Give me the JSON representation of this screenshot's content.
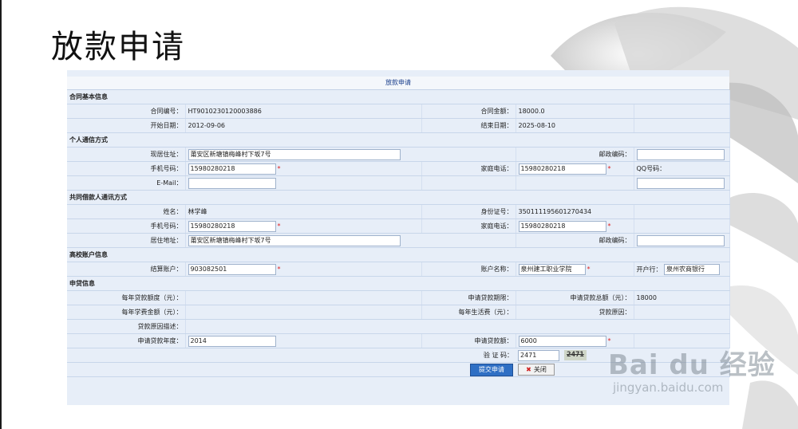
{
  "slide": {
    "title": "放款申请"
  },
  "watermark": {
    "brand": "Bai du 经验",
    "url": "jingyan.baidu.com"
  },
  "form": {
    "title": "放款申请",
    "sections": {
      "contract": "合同基本信息",
      "contact": "个人通信方式",
      "co_borrower": "共同借款人通讯方式",
      "bank": "高校账户信息",
      "apply": "申贷信息"
    },
    "contract": {
      "no_label": "合同编号：",
      "no": "HT9010230120003886",
      "amount_label": "合同金额：",
      "amount": "18000.0",
      "start_label": "开始日期：",
      "start": "2012-09-06",
      "end_label": "结束日期：",
      "end": "2025-08-10"
    },
    "contact": {
      "address_label": "现居住址：",
      "address": "莆安区新塘镇梅峰村下坂7号",
      "zip_label": "邮政编码：",
      "zip": "",
      "mobile_label": "手机号码：",
      "mobile": "15980280218",
      "home_label": "家庭电话：",
      "home": "15980280218",
      "qq_label": "QQ号码：",
      "qq": "",
      "email_label": "E-Mail：",
      "email": ""
    },
    "co_borrower": {
      "name_label": "姓名：",
      "name": "林学峰",
      "id_label": "身份证号：",
      "id": "350111195601270434",
      "mobile_label": "手机号码：",
      "mobile": "15980280218",
      "home_label": "家庭电话：",
      "home": "15980280218",
      "address_label": "居住地址：",
      "address": "莆安区新塘镇梅峰村下坂7号",
      "zip_label": "邮政编码：",
      "zip": ""
    },
    "bank": {
      "account_label": "结算账户：",
      "account": "903082501",
      "holder_label": "账户名称：",
      "holder": "泉州建工职业学院",
      "open_bank_label": "开户行：",
      "open_bank": "泉州农商银行"
    },
    "apply": {
      "annual_limit_label": "每年贷款额度（元）：",
      "annual_limit": "",
      "term_label": "申请贷款期限：",
      "term": "",
      "total_label": "申请贷款总额（元）：",
      "total": "18000",
      "tuition_label": "每年学费金额（元）：",
      "tuition": "",
      "living_label": "每年生活费（元）：",
      "living": "",
      "reason_label": "贷款原因：",
      "reason": "",
      "reason_desc_label": "贷款原因描述：",
      "reason_desc": "",
      "year_label": "申请贷款年度：",
      "year": "2014",
      "amount_label": "申请贷款额：",
      "amount": "6000"
    },
    "captcha": {
      "label": "验 证 码：",
      "value": "2471",
      "image_text": "2471"
    },
    "buttons": {
      "submit": "提交申请",
      "close": "关闭"
    }
  }
}
